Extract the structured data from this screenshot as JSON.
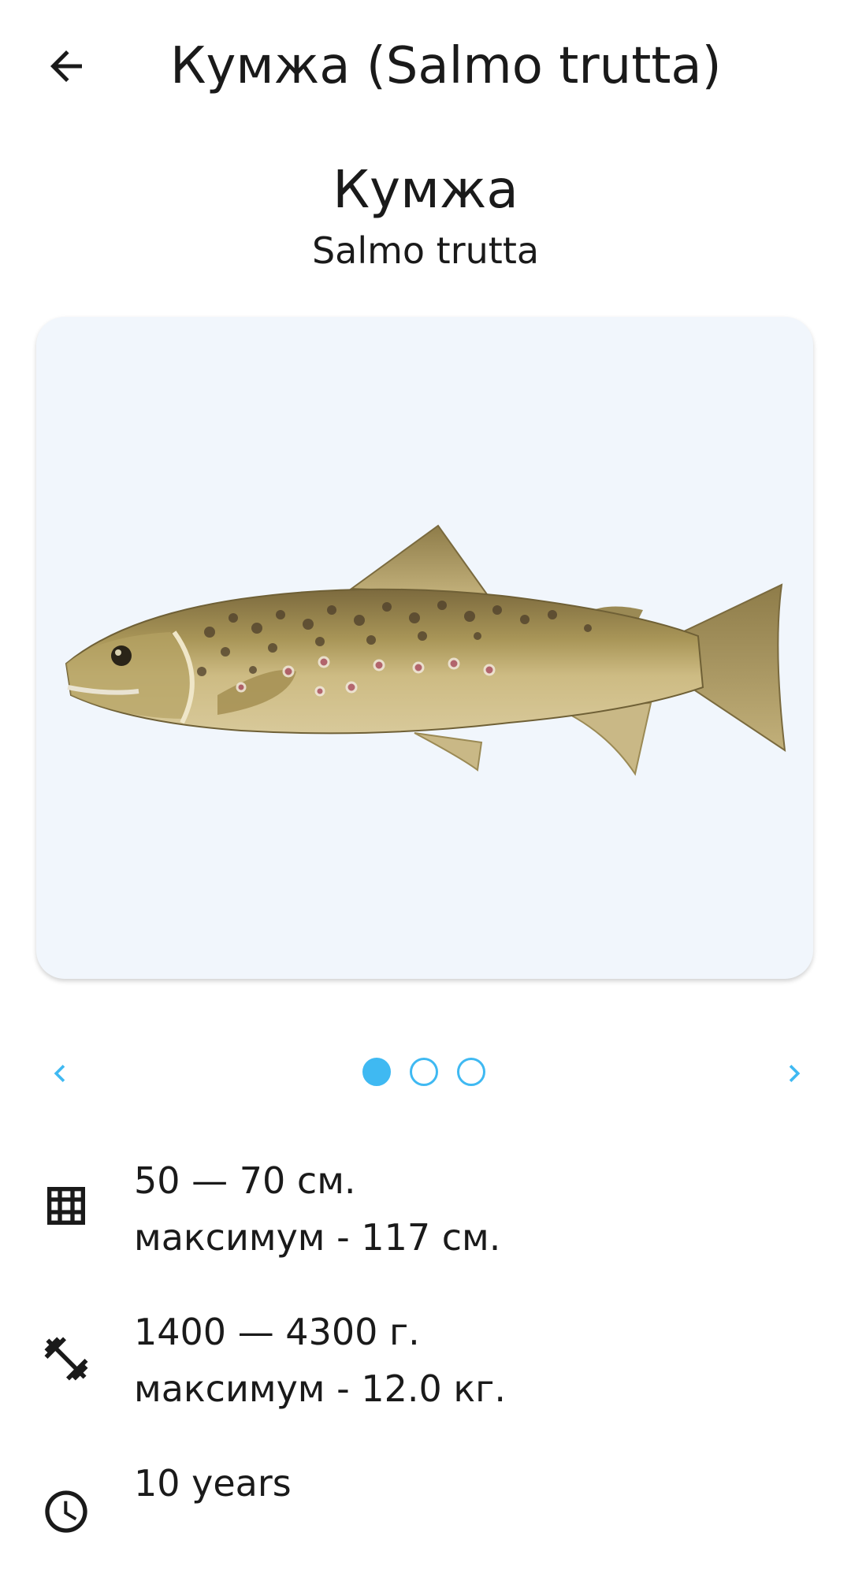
{
  "appbar": {
    "title": "Кумжа (Salmo trutta)",
    "back_icon": "arrow-left-icon"
  },
  "species": {
    "common_name": "Кумжа",
    "latin_name": "Salmo trutta"
  },
  "gallery": {
    "image": "brown-trout-illustration",
    "background": "#f1f6fc",
    "pages_total": 3,
    "current_page": 1,
    "prev_icon": "chevron-left-icon",
    "next_icon": "chevron-right-icon",
    "accent": "#3fb9f2"
  },
  "facts": [
    {
      "icon": "grid-ruler-icon",
      "line1": "50 — 70 см.",
      "line2": "максимум - 117 см."
    },
    {
      "icon": "dumbbell-icon",
      "line1": "1400 — 4300 г.",
      "line2": "максимум - 12.0 кг."
    },
    {
      "icon": "clock-icon",
      "line1": "10 years"
    }
  ]
}
